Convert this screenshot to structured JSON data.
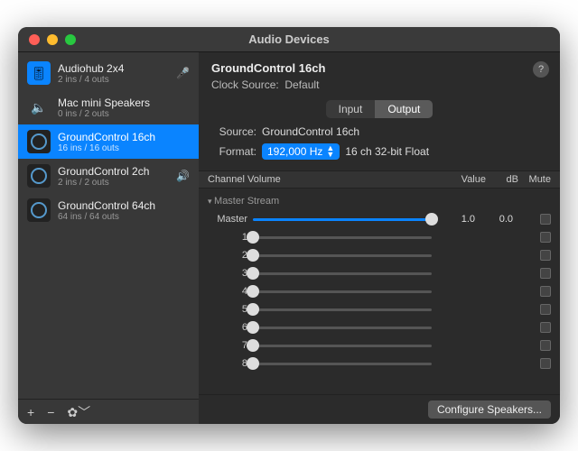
{
  "window": {
    "title": "Audio Devices"
  },
  "sidebar": {
    "devices": [
      {
        "name": "Audiohub 2x4",
        "sub": "2 ins / 4 outs",
        "icon": "blue",
        "side": "mic"
      },
      {
        "name": "Mac mini Speakers",
        "sub": "0 ins / 2 outs",
        "icon": "speaker",
        "side": ""
      },
      {
        "name": "GroundControl 16ch",
        "sub": "16 ins / 16 outs",
        "icon": "ring",
        "side": "",
        "selected": true
      },
      {
        "name": "GroundControl 2ch",
        "sub": "2 ins / 2 outs",
        "icon": "ring",
        "side": "vol"
      },
      {
        "name": "GroundControl 64ch",
        "sub": "64 ins / 64 outs",
        "icon": "ring",
        "side": ""
      }
    ]
  },
  "main": {
    "title": "GroundControl 16ch",
    "clock_label": "Clock Source:",
    "clock_value": "Default",
    "tabs": {
      "input": "Input",
      "output": "Output",
      "active": "output"
    },
    "source_label": "Source:",
    "source_value": "GroundControl 16ch",
    "format_label": "Format:",
    "format_rate": "192,000 Hz",
    "format_desc": "16 ch 32-bit Float",
    "table": {
      "name": "Channel Volume",
      "value": "Value",
      "db": "dB",
      "mute": "Mute"
    },
    "stream_title": "Master Stream",
    "master": {
      "label": "Master",
      "value": "1.0",
      "db": "0.0"
    },
    "channels": [
      {
        "label": "1"
      },
      {
        "label": "2"
      },
      {
        "label": "3"
      },
      {
        "label": "4"
      },
      {
        "label": "5"
      },
      {
        "label": "6"
      },
      {
        "label": "7"
      },
      {
        "label": "8"
      }
    ],
    "configure": "Configure Speakers..."
  }
}
